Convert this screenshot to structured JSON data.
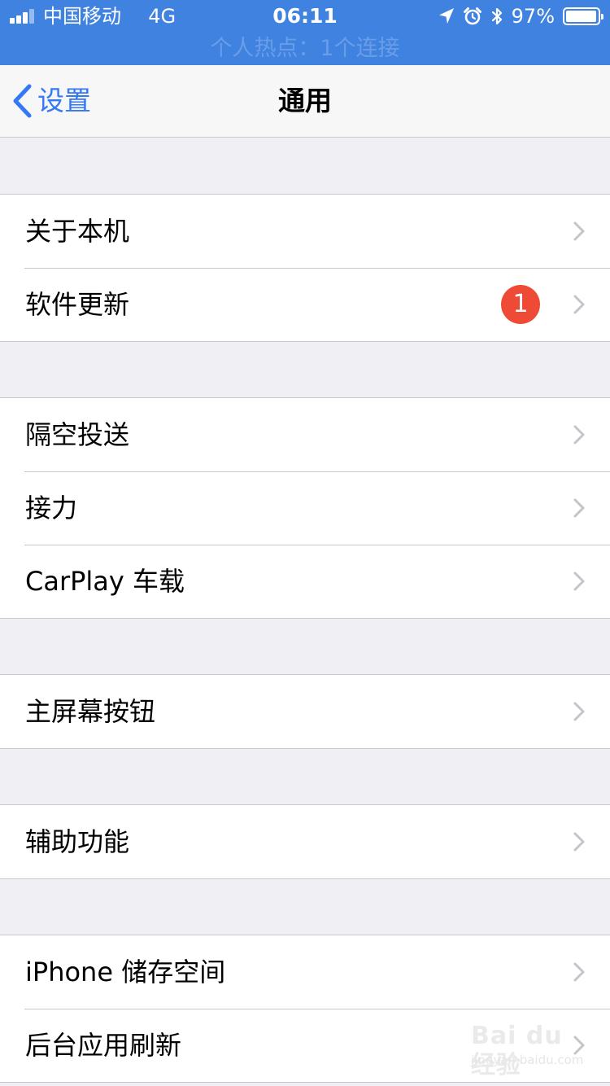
{
  "status_bar": {
    "carrier": "中国移动",
    "network": "4G",
    "time": "06:11",
    "battery_percent": "97%",
    "battery_level": 0.97,
    "hotspot_text": "个人热点：1个连接",
    "icons": [
      "signal-icon",
      "location-arrow-icon",
      "alarm-clock-icon",
      "bluetooth-icon",
      "battery-icon"
    ],
    "bar_color": "#3f82e0"
  },
  "nav": {
    "back_label": "设置",
    "title": "通用",
    "accent_color": "#3478f6"
  },
  "groups": [
    {
      "rows": [
        {
          "label": "关于本机"
        },
        {
          "label": "软件更新",
          "badge": "1"
        }
      ]
    },
    {
      "rows": [
        {
          "label": "隔空投送"
        },
        {
          "label": "接力"
        },
        {
          "label": "CarPlay 车载"
        }
      ]
    },
    {
      "rows": [
        {
          "label": "主屏幕按钮"
        }
      ]
    },
    {
      "rows": [
        {
          "label": "辅助功能"
        }
      ]
    },
    {
      "rows": [
        {
          "label": "iPhone 储存空间"
        },
        {
          "label": "后台应用刷新"
        }
      ]
    }
  ],
  "badge_color": "#ee4a35",
  "watermark": {
    "main": "Bai du 经验",
    "sub": "jingyan.baidu.com"
  }
}
